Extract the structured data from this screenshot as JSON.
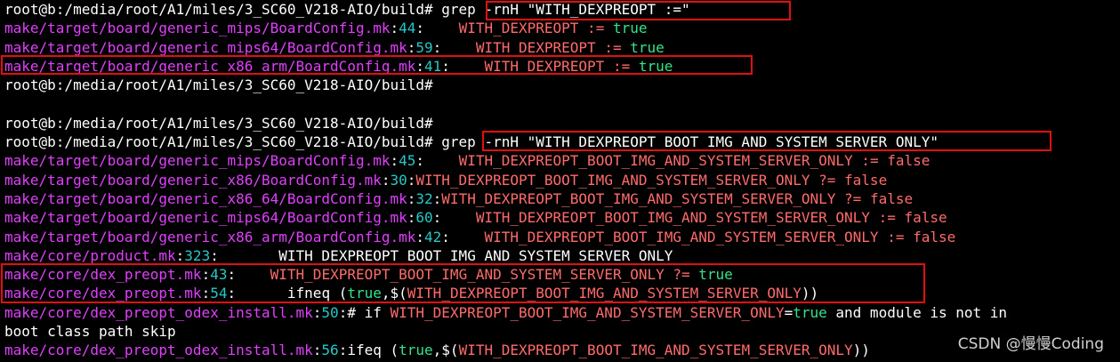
{
  "terminal": {
    "lines": [
      {
        "segments": [
          {
            "t": "root@b:/media/root/A1/miles/3_SC60_V218-AIO/build# ",
            "c": "prompt"
          },
          {
            "t": "grep -rnH \"WITH_DEXPREOPT :=\"",
            "c": "white"
          }
        ]
      },
      {
        "segments": [
          {
            "t": "make/target/board/generic_mips/BoardConfig.mk",
            "c": "path"
          },
          {
            "t": ":",
            "c": "sep"
          },
          {
            "t": "44",
            "c": "num"
          },
          {
            "t": ":    ",
            "c": "sep"
          },
          {
            "t": "WITH_DEXPREOPT := ",
            "c": "var"
          },
          {
            "t": "true",
            "c": "true"
          }
        ]
      },
      {
        "segments": [
          {
            "t": "make/target/board/generic_mips64/BoardConfig.mk",
            "c": "path"
          },
          {
            "t": ":",
            "c": "sep"
          },
          {
            "t": "59",
            "c": "num"
          },
          {
            "t": ":    ",
            "c": "sep"
          },
          {
            "t": "WITH_DEXPREOPT := ",
            "c": "var"
          },
          {
            "t": "true",
            "c": "true"
          }
        ]
      },
      {
        "segments": [
          {
            "t": "make/target/board/generic_x86_arm/BoardConfig.mk",
            "c": "path"
          },
          {
            "t": ":",
            "c": "sep"
          },
          {
            "t": "41",
            "c": "num"
          },
          {
            "t": ":    ",
            "c": "sep"
          },
          {
            "t": "WITH_DEXPREOPT := ",
            "c": "var"
          },
          {
            "t": "true",
            "c": "true"
          }
        ]
      },
      {
        "segments": [
          {
            "t": "root@b:/media/root/A1/miles/3_SC60_V218-AIO/build#",
            "c": "prompt"
          }
        ]
      },
      {
        "segments": [
          {
            "t": " ",
            "c": "prompt"
          }
        ]
      },
      {
        "segments": [
          {
            "t": "root@b:/media/root/A1/miles/3_SC60_V218-AIO/build#",
            "c": "prompt"
          }
        ]
      },
      {
        "segments": [
          {
            "t": "root@b:/media/root/A1/miles/3_SC60_V218-AIO/build# ",
            "c": "prompt"
          },
          {
            "t": "grep -rnH \"WITH_DEXPREOPT_BOOT_IMG_AND_SYSTEM_SERVER_ONLY\"",
            "c": "white"
          }
        ]
      },
      {
        "segments": [
          {
            "t": "make/target/board/generic_mips/BoardConfig.mk",
            "c": "path"
          },
          {
            "t": ":",
            "c": "sep"
          },
          {
            "t": "45",
            "c": "num"
          },
          {
            "t": ":    ",
            "c": "sep"
          },
          {
            "t": "WITH_DEXPREOPT_BOOT_IMG_AND_SYSTEM_SERVER_ONLY := ",
            "c": "var"
          },
          {
            "t": "false",
            "c": "false"
          }
        ]
      },
      {
        "segments": [
          {
            "t": "make/target/board/generic_x86/BoardConfig.mk",
            "c": "path"
          },
          {
            "t": ":",
            "c": "sep"
          },
          {
            "t": "30",
            "c": "num"
          },
          {
            "t": ":",
            "c": "sep"
          },
          {
            "t": "WITH_DEXPREOPT_BOOT_IMG_AND_SYSTEM_SERVER_ONLY ?= ",
            "c": "var"
          },
          {
            "t": "false",
            "c": "false"
          }
        ]
      },
      {
        "segments": [
          {
            "t": "make/target/board/generic_x86_64/BoardConfig.mk",
            "c": "path"
          },
          {
            "t": ":",
            "c": "sep"
          },
          {
            "t": "32",
            "c": "num"
          },
          {
            "t": ":",
            "c": "sep"
          },
          {
            "t": "WITH_DEXPREOPT_BOOT_IMG_AND_SYSTEM_SERVER_ONLY ?= ",
            "c": "var"
          },
          {
            "t": "false",
            "c": "false"
          }
        ]
      },
      {
        "segments": [
          {
            "t": "make/target/board/generic_mips64/BoardConfig.mk",
            "c": "path"
          },
          {
            "t": ":",
            "c": "sep"
          },
          {
            "t": "60",
            "c": "num"
          },
          {
            "t": ":    ",
            "c": "sep"
          },
          {
            "t": "WITH_DEXPREOPT_BOOT_IMG_AND_SYSTEM_SERVER_ONLY := ",
            "c": "var"
          },
          {
            "t": "false",
            "c": "false"
          }
        ]
      },
      {
        "segments": [
          {
            "t": "make/target/board/generic_x86_arm/BoardConfig.mk",
            "c": "path"
          },
          {
            "t": ":",
            "c": "sep"
          },
          {
            "t": "42",
            "c": "num"
          },
          {
            "t": ":    ",
            "c": "sep"
          },
          {
            "t": "WITH_DEXPREOPT_BOOT_IMG_AND_SYSTEM_SERVER_ONLY := ",
            "c": "var"
          },
          {
            "t": "false",
            "c": "false"
          }
        ]
      },
      {
        "segments": [
          {
            "t": "make/core/product.mk",
            "c": "path"
          },
          {
            "t": ":",
            "c": "sep"
          },
          {
            "t": "323",
            "c": "num"
          },
          {
            "t": ":       ",
            "c": "sep"
          },
          {
            "t": "WITH_DEXPREOPT_BOOT_IMG_AND_SYSTEM_SERVER_ONLY",
            "c": "white"
          }
        ]
      },
      {
        "segments": [
          {
            "t": "make/core/dex_preopt.mk",
            "c": "path"
          },
          {
            "t": ":",
            "c": "sep"
          },
          {
            "t": "43",
            "c": "num"
          },
          {
            "t": ":    ",
            "c": "sep"
          },
          {
            "t": "WITH_DEXPREOPT_BOOT_IMG_AND_SYSTEM_SERVER_ONLY ?= ",
            "c": "var"
          },
          {
            "t": "true",
            "c": "true"
          }
        ]
      },
      {
        "segments": [
          {
            "t": "make/core/dex_preopt.mk",
            "c": "path"
          },
          {
            "t": ":",
            "c": "sep"
          },
          {
            "t": "54",
            "c": "num"
          },
          {
            "t": ":      ",
            "c": "sep"
          },
          {
            "t": "ifneq (",
            "c": "white"
          },
          {
            "t": "true",
            "c": "true"
          },
          {
            "t": ",$(",
            "c": "white"
          },
          {
            "t": "WITH_DEXPREOPT_BOOT_IMG_AND_SYSTEM_SERVER_ONLY",
            "c": "var"
          },
          {
            "t": "))",
            "c": "white"
          }
        ]
      },
      {
        "segments": [
          {
            "t": "make/core/dex_preopt_odex_install.mk",
            "c": "path"
          },
          {
            "t": ":",
            "c": "sep"
          },
          {
            "t": "50",
            "c": "num"
          },
          {
            "t": ":# if ",
            "c": "white"
          },
          {
            "t": "WITH_DEXPREOPT_BOOT_IMG_AND_SYSTEM_SERVER_ONLY",
            "c": "var"
          },
          {
            "t": "=",
            "c": "white"
          },
          {
            "t": "true",
            "c": "true"
          },
          {
            "t": " and module is not in",
            "c": "white"
          }
        ]
      },
      {
        "segments": [
          {
            "t": "boot class path skip",
            "c": "white"
          }
        ]
      },
      {
        "segments": [
          {
            "t": "make/core/dex_preopt_odex_install.mk",
            "c": "path"
          },
          {
            "t": ":",
            "c": "sep"
          },
          {
            "t": "56",
            "c": "num"
          },
          {
            "t": ":ifeq (",
            "c": "white"
          },
          {
            "t": "true",
            "c": "true"
          },
          {
            "t": ",$(",
            "c": "white"
          },
          {
            "t": "WITH_DEXPREOPT_BOOT_IMG_AND_SYSTEM_SERVER_ONLY",
            "c": "var"
          },
          {
            "t": "))",
            "c": "white"
          }
        ]
      }
    ]
  },
  "watermark": "CSDN @慢慢Coding",
  "colors": {
    "background": "#000000",
    "path": "#e040fb",
    "line_number": "#25c8c8",
    "variable": "#ff6b6b",
    "true": "#33e38a",
    "false": "#ff6b6b",
    "highlight_box": "#e01010"
  }
}
